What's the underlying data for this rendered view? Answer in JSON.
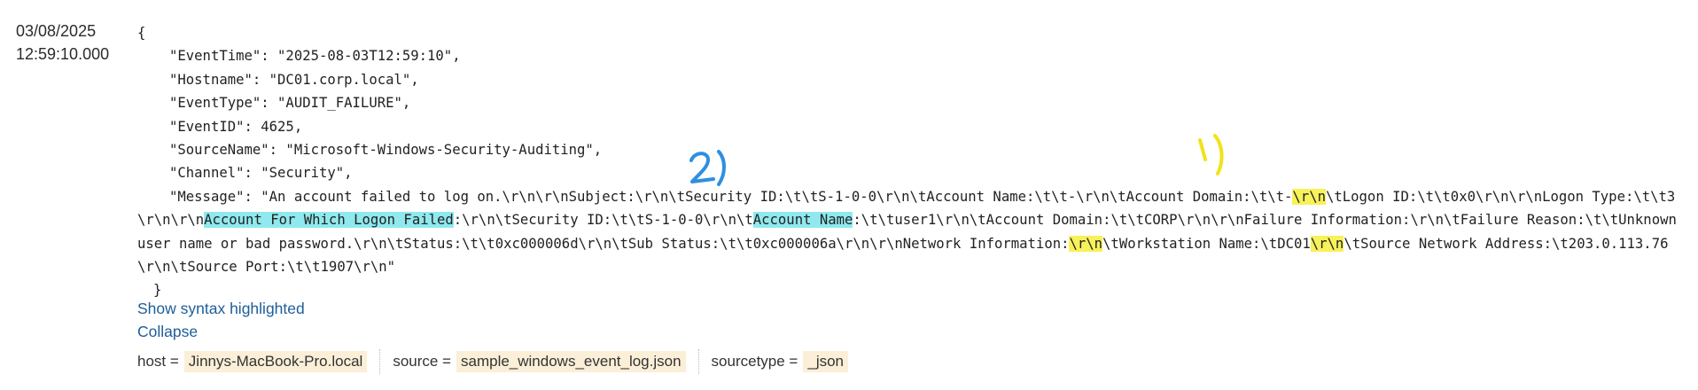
{
  "timestamp": {
    "date": "03/08/2025",
    "time": "12:59:10.000"
  },
  "event": {
    "open_brace": "{",
    "close_brace": "}",
    "lines": [
      "\"EventTime\": \"2025-08-03T12:59:10\",",
      "\"Hostname\": \"DC01.corp.local\",",
      "\"EventType\": \"AUDIT_FAILURE\",",
      "\"EventID\": 4625,",
      "\"SourceName\": \"Microsoft-Windows-Security-Auditing\",",
      "\"Channel\": \"Security\","
    ],
    "message_parts": [
      "\"Message\": \"An account failed to log on.\\r\\n\\r\\nSubject:\\r\\n\\tSecurity ID:\\t\\tS-1-0-0\\r\\n\\tAccount Name:\\t\\t-\\r\\n\\tAccount Domain:\\t\\t-",
      "\\r\\n",
      "\\tLogon ID:\\t\\t0x0\\r\\n\\r\\nLogon Type:\\t\\t3\\r\\n\\r\\n",
      "Account For Which Logon Failed",
      ":\\r\\n\\tSecurity ID:\\t\\tS-1-0-0\\r\\n\\t",
      "Account Name",
      ":\\t\\tuser1\\r\\n\\tAccount Domain:\\t\\tCORP\\r\\n\\r\\nFailure Information:\\r\\n\\tFailure Reason:\\t\\tUnknown user name or bad password.\\r\\n\\tStatus:\\t\\t0xc000006d\\r\\n\\tSub Status:\\t\\t0xc000006a\\r\\n\\r\\nNetwork Information:",
      "\\r\\n",
      "\\tWorkstation Name:\\tDC01",
      "\\r\\n",
      "\\tSource Network Address:\\t203.0.113.76\\r\\n\\tSource Port:\\t\\t1907\\r\\n\""
    ]
  },
  "links": {
    "show_syntax": "Show syntax highlighted",
    "collapse": "Collapse"
  },
  "fields": [
    {
      "key": "host =",
      "value": "Jinnys-MacBook-Pro.local"
    },
    {
      "key": "source =",
      "value": "sample_windows_event_log.json"
    },
    {
      "key": "sourcetype =",
      "value": "_json"
    }
  ],
  "annotations": {
    "label_1": "1)",
    "label_2": "2)",
    "color_1": "#f2e21a",
    "color_2": "#2f8fe0"
  },
  "colors": {
    "cyan_highlight": "#8fe9ee",
    "yellow_highlight": "#f7f15a",
    "link": "#1f5d99",
    "field_value_bg": "#fbefd8"
  }
}
